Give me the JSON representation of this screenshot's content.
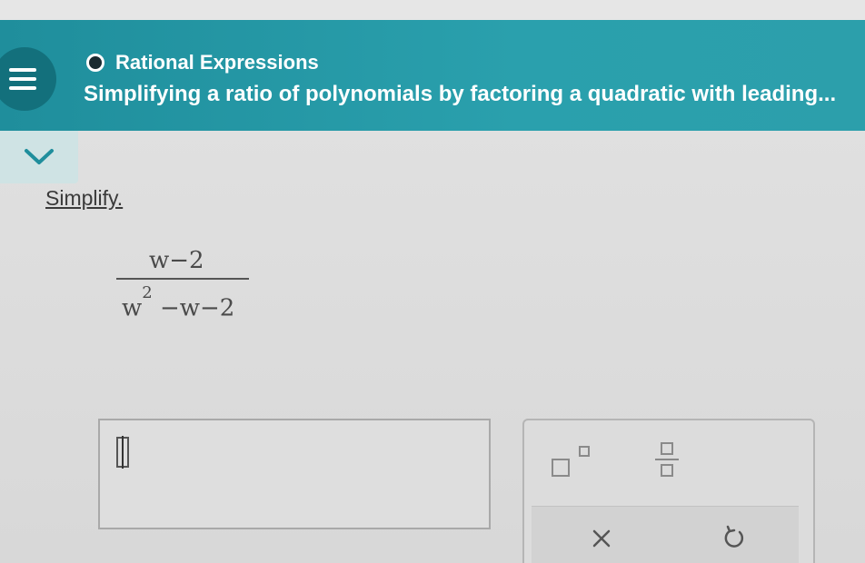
{
  "header": {
    "topic": "Rational Expressions",
    "title": "Simplifying a ratio of polynomials by factoring a quadratic with leading..."
  },
  "problem": {
    "prompt": "Simplify.",
    "numerator": "w−2",
    "denominator_base": "w",
    "denominator_exp": "2",
    "denominator_rest": " −w−2"
  },
  "answer": {
    "value": ""
  },
  "keypad": {
    "keys": [
      "exponent-key",
      "fraction-key"
    ],
    "actions": [
      "clear",
      "undo"
    ]
  },
  "icons": {
    "menu": "hamburger-icon",
    "collapse": "chevron-down-icon",
    "topic": "circle-bullet-icon",
    "clear": "x-icon",
    "undo": "undo-icon"
  },
  "colors": {
    "header": "#2aa0ad",
    "menu_button": "#13707c",
    "chevron_tab": "#cfe3e4",
    "background": "#dcdcdc"
  }
}
